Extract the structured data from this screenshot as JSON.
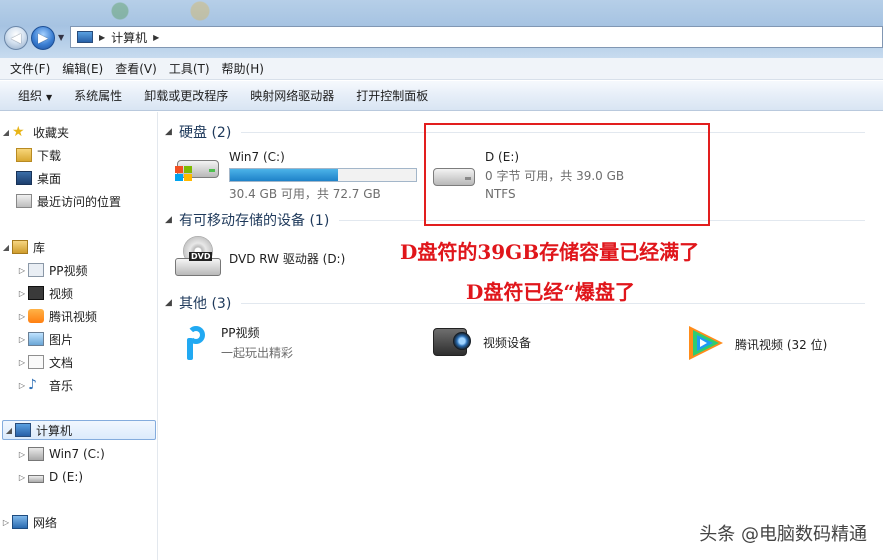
{
  "address": {
    "path": "计算机"
  },
  "menu": [
    "文件(F)",
    "编辑(E)",
    "查看(V)",
    "工具(T)",
    "帮助(H)"
  ],
  "commands": {
    "organize": "组织",
    "items": [
      "系统属性",
      "卸载或更改程序",
      "映射网络驱动器",
      "打开控制面板"
    ]
  },
  "sidebar": {
    "favorites": "收藏夹",
    "fav_items": [
      "下载",
      "桌面",
      "最近访问的位置"
    ],
    "libraries": "库",
    "lib_items": [
      "PP视频",
      "视频",
      "腾讯视频",
      "图片",
      "文档",
      "音乐"
    ],
    "computer": "计算机",
    "drives": [
      "Win7 (C:)",
      "D (E:)"
    ],
    "network": "网络"
  },
  "groups": {
    "hdd": "硬盘 (2)",
    "removable": "有可移动存储的设备 (1)",
    "other": "其他 (3)"
  },
  "drive_c": {
    "name": "Win7 (C:)",
    "space": "30.4 GB 可用，共 72.7 GB",
    "used_fraction": 0.582
  },
  "drive_d": {
    "name": "D (E:)",
    "space": "0 字节 可用，共 39.0 GB",
    "fs": "NTFS"
  },
  "dvd": {
    "name": "DVD RW 驱动器 (D:)",
    "badge": "DVD"
  },
  "other_items": {
    "pp": {
      "name": "PP视频",
      "desc": "一起玩出精彩"
    },
    "cam": {
      "name": "视频设备"
    },
    "tx": {
      "name": "腾讯视频 (32 位)"
    }
  },
  "annotations": {
    "line1": "D盘符的39GB存储容量已经满了",
    "line2": "D盘符已经“爆盘了"
  },
  "watermark": "头条 @电脑数码精通",
  "colors": {
    "annotation": "#e0161b",
    "bar_fill": "#1e82c8"
  }
}
